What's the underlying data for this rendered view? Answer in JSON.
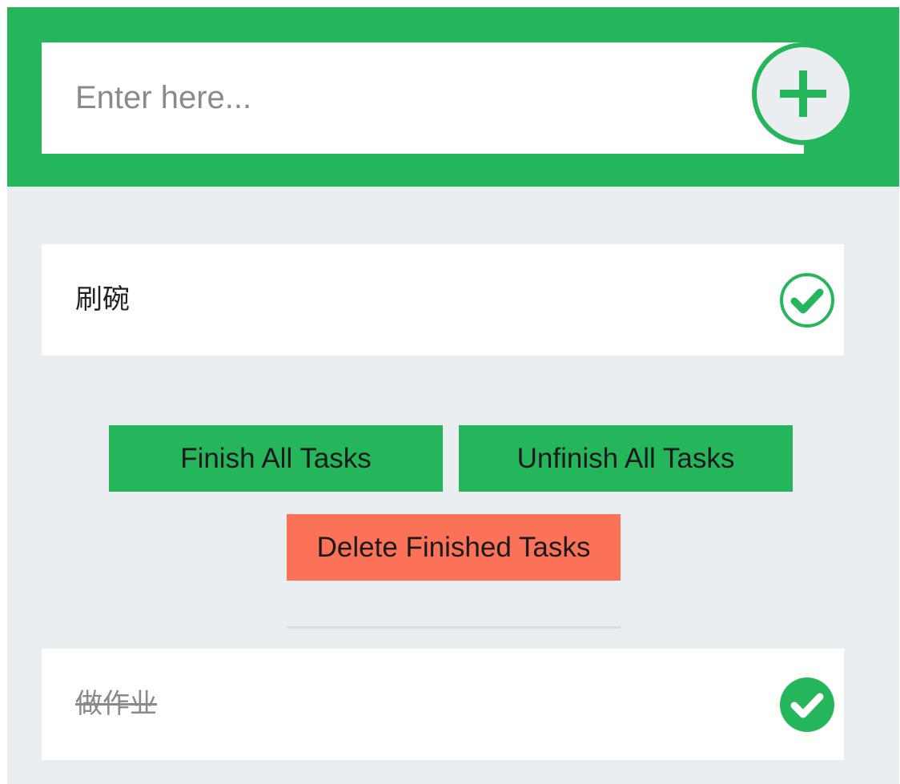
{
  "input": {
    "placeholder": "Enter here...",
    "value": ""
  },
  "add_button": {
    "icon": "plus-icon"
  },
  "todo_tasks": [
    {
      "text": "刷碗",
      "done": false,
      "icon": "check-circle-outline-icon"
    }
  ],
  "actions": {
    "finish_all_label": "Finish All Tasks",
    "unfinish_all_label": "Unfinish All Tasks",
    "delete_finished_label": "Delete Finished Tasks"
  },
  "finished_tasks": [
    {
      "text": "做作业",
      "done": true,
      "icon": "check-circle-filled-icon"
    }
  ],
  "colors": {
    "accent": "#25b65c",
    "danger": "#fb7258",
    "background": "#eaeef0"
  }
}
